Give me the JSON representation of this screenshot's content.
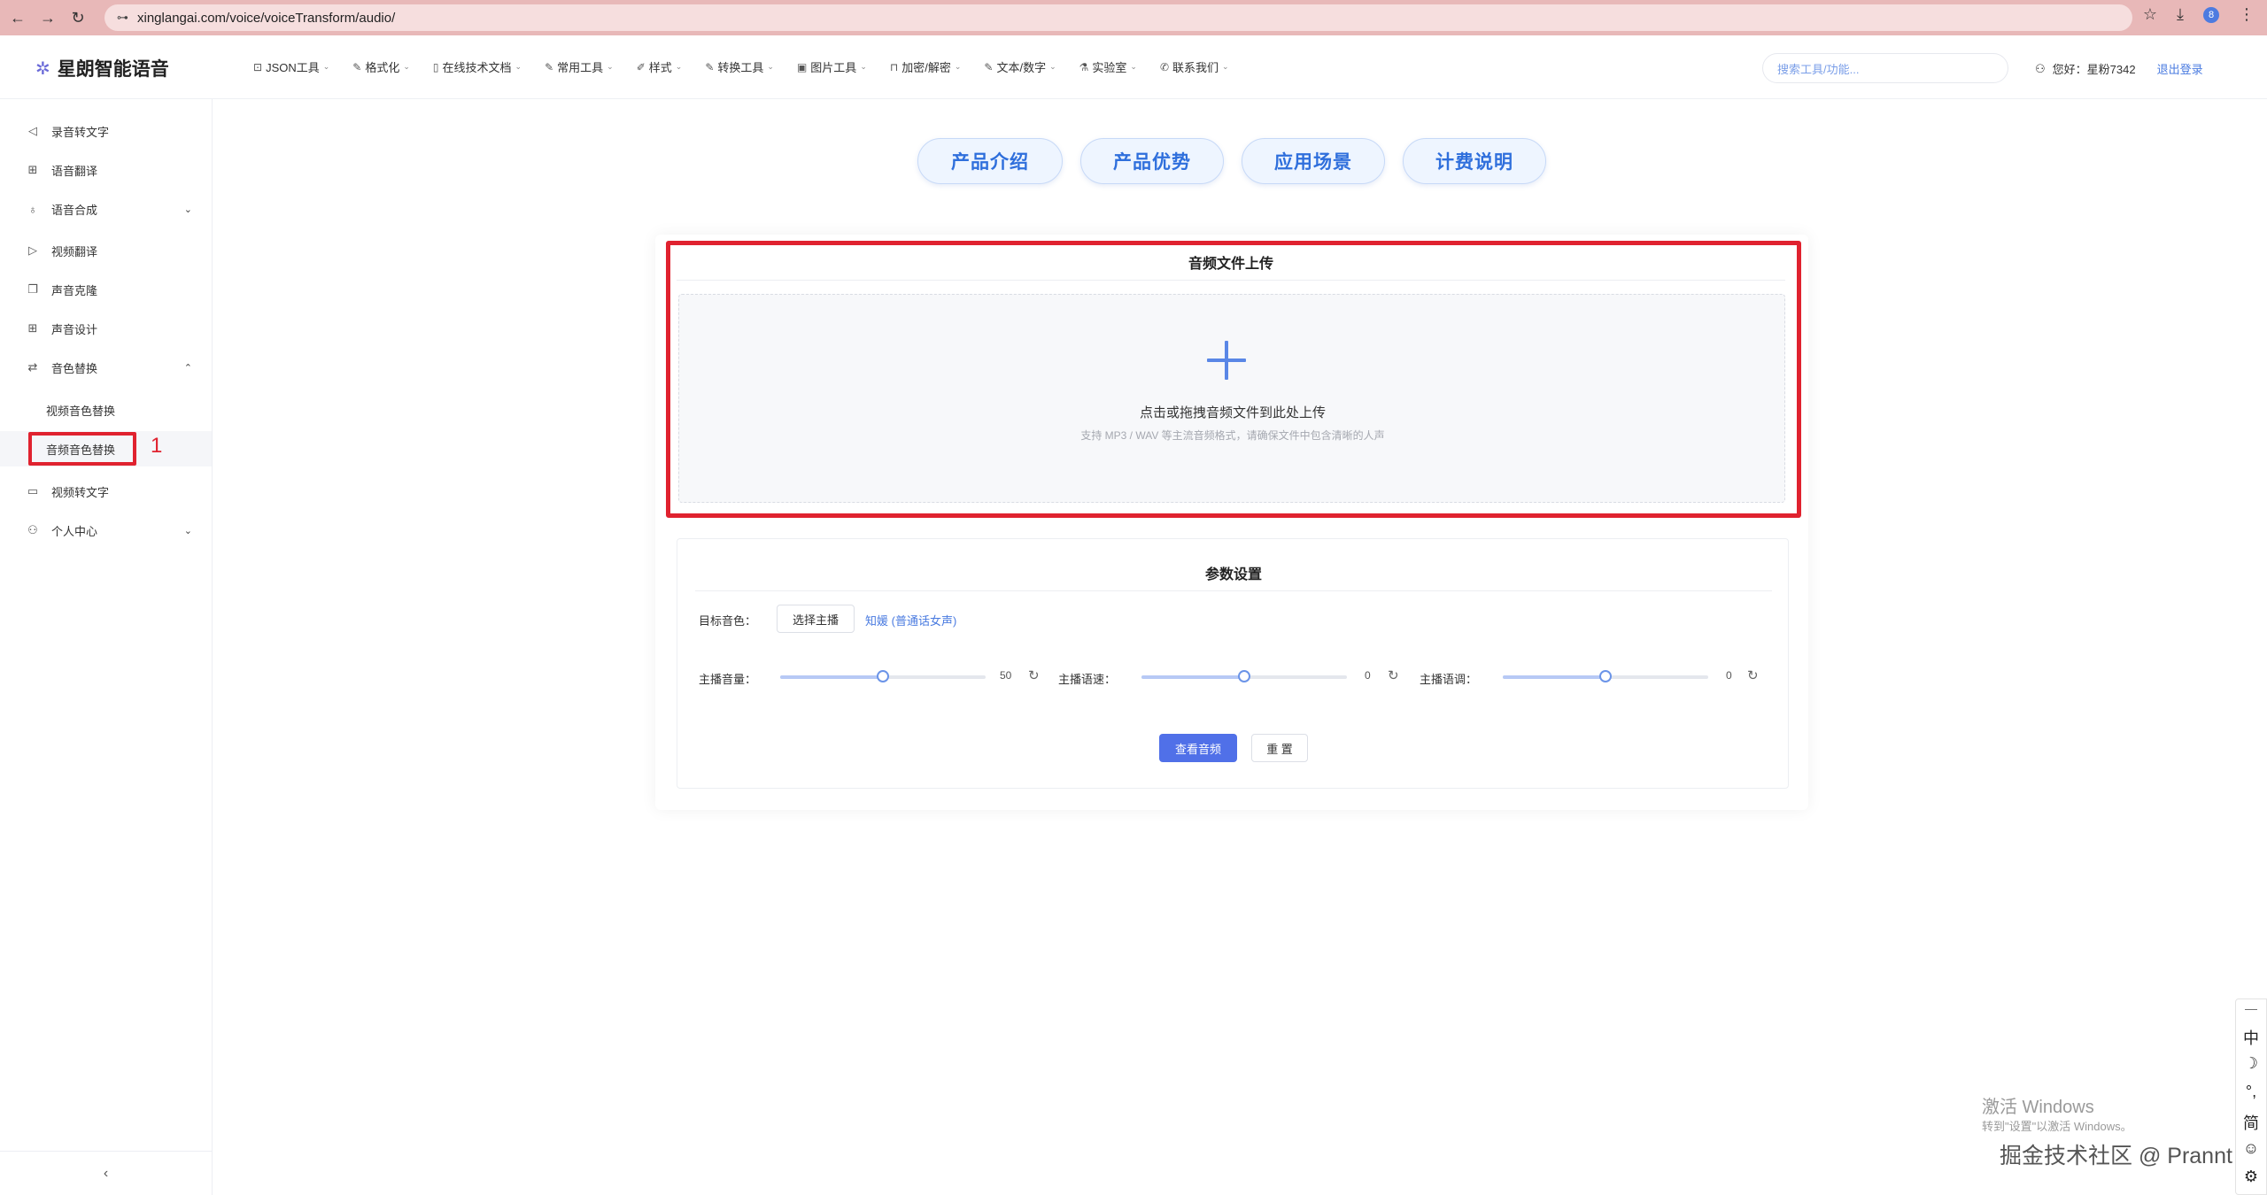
{
  "browser": {
    "url": "xinglangai.com/voice/voiceTransform/audio/",
    "profile_initial": "8"
  },
  "site": {
    "logo_text": "星朗智能语音",
    "menu": [
      {
        "label": "JSON工具",
        "icon": "code-icon"
      },
      {
        "label": "格式化",
        "icon": "edit-icon"
      },
      {
        "label": "在线技术文档",
        "icon": "document-icon"
      },
      {
        "label": "常用工具",
        "icon": "edit-icon"
      },
      {
        "label": "样式",
        "icon": "brush-icon"
      },
      {
        "label": "转换工具",
        "icon": "edit-icon"
      },
      {
        "label": "图片工具",
        "icon": "image-icon"
      },
      {
        "label": "加密/解密",
        "icon": "lock-icon"
      },
      {
        "label": "文本/数字",
        "icon": "edit-icon"
      },
      {
        "label": "实验室",
        "icon": "flask-icon"
      },
      {
        "label": "联系我们",
        "icon": "phone-icon"
      }
    ],
    "search_placeholder": "搜索工具/功能...",
    "greeting": "您好：星粉7342",
    "logout": "退出登录"
  },
  "sidebar": {
    "items": [
      {
        "label": "录音转文字",
        "icon": "speaker-icon"
      },
      {
        "label": "语音翻译",
        "icon": "translate-icon"
      },
      {
        "label": "语音合成",
        "icon": "mic-icon"
      },
      {
        "label": "视频翻译",
        "icon": "play-icon"
      },
      {
        "label": "声音克隆",
        "icon": "copy-icon"
      },
      {
        "label": "声音设计",
        "icon": "grid-icon"
      },
      {
        "label": "音色替换",
        "icon": "swap-icon"
      },
      {
        "label": "视频转文字",
        "icon": "video-icon"
      },
      {
        "label": "个人中心",
        "icon": "user-icon"
      }
    ],
    "sub_items": [
      "视频音色替换",
      "音频音色替换"
    ],
    "annotation": "1"
  },
  "tabs": [
    "产品介绍",
    "产品优势",
    "应用场景",
    "计费说明"
  ],
  "upload": {
    "title": "音频文件上传",
    "main_text": "点击或拖拽音频文件到此处上传",
    "sub_text": "支持 MP3 / WAV 等主流音频格式，请确保文件中包含清晰的人声"
  },
  "params": {
    "title": "参数设置",
    "target_voice_label": "目标音色：",
    "choose_button": "选择主播",
    "selected_voice": "知媛 (普通话女声)",
    "sliders": [
      {
        "label": "主播音量：",
        "value": "50",
        "fill": 0.5
      },
      {
        "label": "主播语速：",
        "value": "0",
        "fill": 0.5
      },
      {
        "label": "主播语调：",
        "value": "0",
        "fill": 0.5
      }
    ],
    "submit_button": "查看音频",
    "reset_button": "重 置"
  },
  "ime": [
    "中",
    "☽",
    "°,",
    "简",
    "☺",
    "⚙"
  ],
  "watermarks": {
    "windows_title": "激活 Windows",
    "windows_sub": "转到\"设置\"以激活 Windows。",
    "site": "掘金技术社区 @ Prannt"
  },
  "colors": {
    "accent": "#4a7be0",
    "primary_button": "#5070e8",
    "annotation_red": "#e0222f",
    "browser_bar": "#e8b8b8"
  }
}
